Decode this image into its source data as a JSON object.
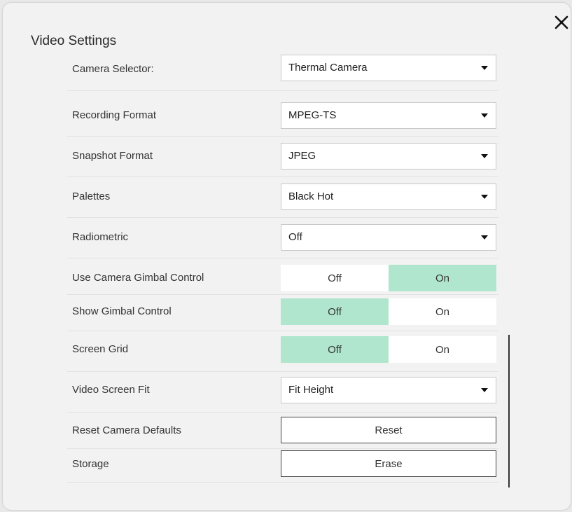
{
  "dialog": {
    "title": "Video Settings",
    "close_icon": "close-icon"
  },
  "settings": {
    "camera_selector": {
      "label": "Camera Selector:",
      "value": "Thermal Camera"
    },
    "recording_format": {
      "label": "Recording Format",
      "value": "MPEG-TS"
    },
    "snapshot_format": {
      "label": "Snapshot Format",
      "value": "JPEG"
    },
    "palettes": {
      "label": "Palettes",
      "value": "Black Hot"
    },
    "radiometric": {
      "label": "Radiometric",
      "value": "Off"
    },
    "use_gimbal": {
      "label": "Use Camera Gimbal Control",
      "off": "Off",
      "on": "On",
      "selected": "On"
    },
    "show_gimbal": {
      "label": "Show Gimbal Control",
      "off": "Off",
      "on": "On",
      "selected": "Off"
    },
    "screen_grid": {
      "label": "Screen Grid",
      "off": "Off",
      "on": "On",
      "selected": "Off"
    },
    "video_fit": {
      "label": "Video Screen Fit",
      "value": "Fit Height"
    },
    "reset": {
      "label": "Reset Camera Defaults",
      "button": "Reset"
    },
    "storage": {
      "label": "Storage",
      "button": "Erase"
    }
  },
  "colors": {
    "toggle_active": "#b0e6cd"
  }
}
